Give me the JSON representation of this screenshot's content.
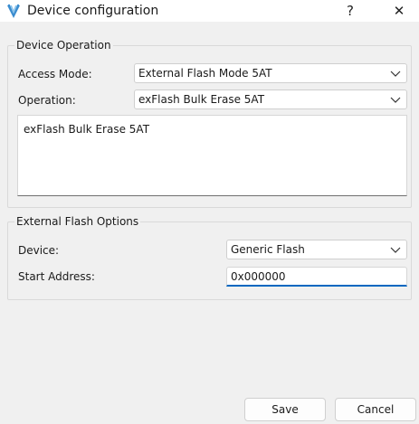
{
  "window": {
    "title": "Device configuration",
    "help_glyph": "?",
    "close_glyph": "✕"
  },
  "device_operation": {
    "group_title": "Device Operation",
    "access_mode_label": "Access Mode:",
    "access_mode_value": "External Flash Mode 5AT",
    "operation_label": "Operation:",
    "operation_value": "exFlash Bulk Erase 5AT",
    "description_text": "exFlash Bulk Erase 5AT"
  },
  "external_flash_options": {
    "group_title": "External Flash Options",
    "device_label": "Device:",
    "device_value": "Generic Flash",
    "start_address_label": "Start Address:",
    "start_address_value": "0x000000"
  },
  "footer": {
    "save_label": "Save",
    "cancel_label": "Cancel"
  },
  "colors": {
    "accent": "#0067c0",
    "background": "#f0f0f0",
    "logo_blue": "#3a8ccf"
  }
}
